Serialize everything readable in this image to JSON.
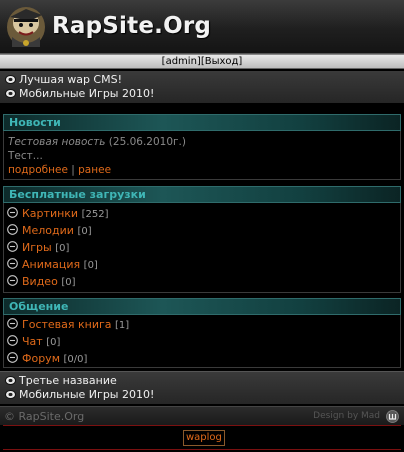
{
  "header": {
    "title": "RapSite.Org",
    "logo_icon": "rapper-mascot-icon"
  },
  "auth": {
    "admin": "[admin]",
    "logout": "[Выход]"
  },
  "top_links": [
    {
      "label": "Лучшая wap CMS!",
      "icon": "bulb-icon"
    },
    {
      "label": "Мобильные Игры 2010!",
      "icon": "bulb-icon"
    }
  ],
  "news": {
    "heading": "Новости",
    "title": "Тестовая новость",
    "date": "(25.06.2010г.)",
    "text": "Тест...",
    "more": "подробнее",
    "separator": "|",
    "earlier": "ранее"
  },
  "downloads": {
    "heading": "Бесплатные загрузки",
    "items": [
      {
        "label": "Картинки",
        "count": "[252]"
      },
      {
        "label": "Мелодии",
        "count": "[0]"
      },
      {
        "label": "Игры",
        "count": "[0]"
      },
      {
        "label": "Анимация",
        "count": "[0]"
      },
      {
        "label": "Видео",
        "count": "[0]"
      }
    ]
  },
  "social": {
    "heading": "Общение",
    "items": [
      {
        "label": "Гостевая книга",
        "count": "[1]"
      },
      {
        "label": "Чат",
        "count": "[0]"
      },
      {
        "label": "Форум",
        "count": "[0/0]"
      }
    ]
  },
  "bottom_links": [
    {
      "label": "Третье название",
      "icon": "bulb-icon"
    },
    {
      "label": "Мобильные Игры 2010!",
      "icon": "bulb-icon"
    }
  ],
  "footer": {
    "copyright": "© RapSite.Org",
    "design": "Design by Mad"
  },
  "counter": {
    "label": "waplog"
  },
  "colors": {
    "accent_orange": "#e06a1a",
    "section_teal": "#3fb6b6",
    "divider_red": "#7a1010"
  }
}
